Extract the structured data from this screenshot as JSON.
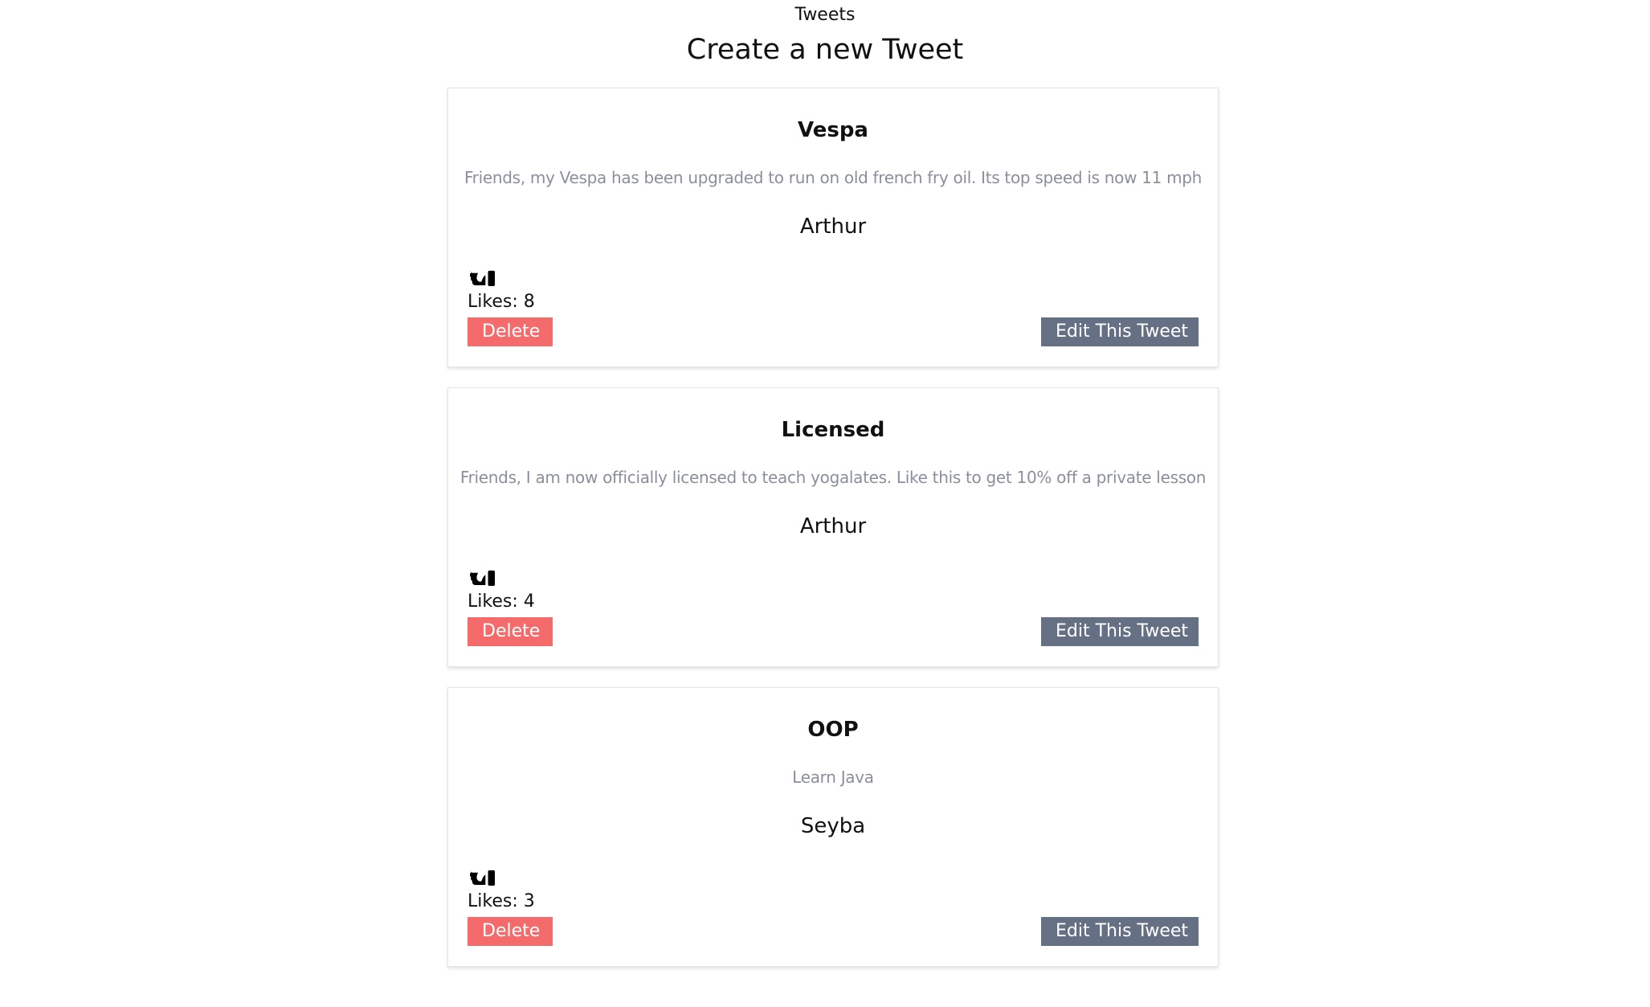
{
  "nav": {
    "tweets_link": "Tweets",
    "create_title": "Create a new Tweet"
  },
  "tweets": [
    {
      "title": "Vespa",
      "body": "Friends, my Vespa has been upgraded to run on old french fry oil. Its top speed is now 11 mph",
      "author": "Arthur",
      "likes_text": "Likes: 8",
      "delete_label": "Delete",
      "edit_label": "Edit This Tweet"
    },
    {
      "title": "Licensed",
      "body": "Friends, I am now officially licensed to teach yogalates. Like this to get 10% off a private lesson",
      "author": "Arthur",
      "likes_text": "Likes: 4",
      "delete_label": "Delete",
      "edit_label": "Edit This Tweet"
    },
    {
      "title": "OOP",
      "body": "Learn Java",
      "author": "Seyba",
      "likes_text": "Likes: 3",
      "delete_label": "Delete",
      "edit_label": "Edit This Tweet"
    }
  ],
  "icons": {
    "like": "thumbs-up-icon"
  },
  "colors": {
    "delete_button": "#f56a6a",
    "edit_button": "#667085",
    "body_text": "#8a8f9c"
  }
}
